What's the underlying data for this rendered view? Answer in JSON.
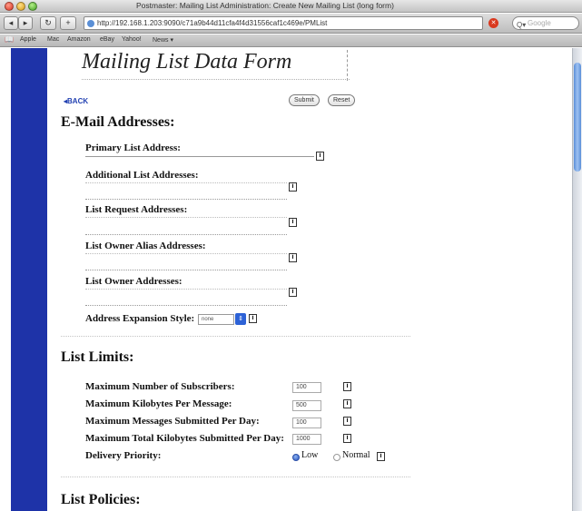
{
  "window": {
    "title": "Postmaster: Mailing List Administration: Create New Mailing List (long form)"
  },
  "toolbar": {
    "back": "◂",
    "forward": "▸",
    "reload": "↻",
    "add": "+",
    "url": "http://192.168.1.203:9090/c71a9b44d11cfa4f4d31556caf1c469e/PMList",
    "search_placeholder": "Google"
  },
  "bookmarks": {
    "items": [
      "Apple",
      "Mac",
      "Amazon",
      "eBay",
      "Yahoo!",
      "News ▾"
    ]
  },
  "page": {
    "title": "Mailing List Data Form",
    "back_label": "◂BACK",
    "submit_label": "Submit",
    "reset_label": "Reset",
    "info_glyph": "i"
  },
  "email": {
    "heading": "E-Mail Addresses:",
    "primary_label": "Primary List Address:",
    "additional_label": "Additional List Addresses:",
    "request_label": "List Request Addresses:",
    "owner_alias_label": "List Owner Alias Addresses:",
    "owner_label": "List Owner Addresses:",
    "expansion_label": "Address Expansion Style:",
    "expansion_value": "none"
  },
  "limits": {
    "heading": "List Limits:",
    "rows": [
      {
        "label": "Maximum Number of Subscribers:",
        "value": "100"
      },
      {
        "label": "Maximum Kilobytes Per Message:",
        "value": "500"
      },
      {
        "label": "Maximum Messages Submitted Per Day:",
        "value": "100"
      },
      {
        "label": "Maximum Total Kilobytes Submitted Per Day:",
        "value": "1000"
      }
    ],
    "priority_label": "Delivery Priority:",
    "priority_low": "Low",
    "priority_normal": "Normal"
  },
  "policies": {
    "heading": "List Policies:"
  }
}
